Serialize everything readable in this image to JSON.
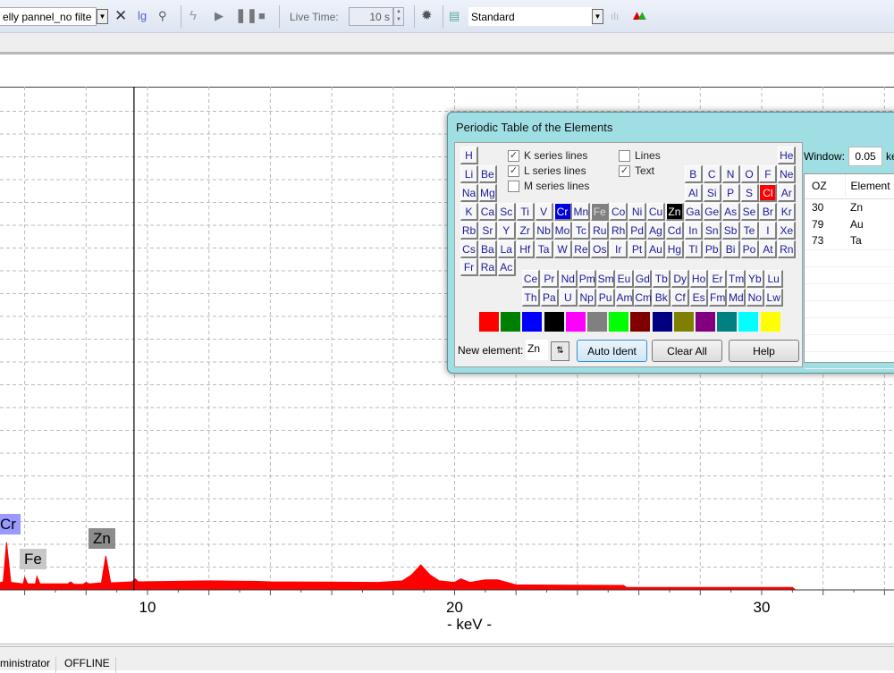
{
  "toolbar": {
    "profile_select": "elly pannel_no filte",
    "live_time_label": "Live Time:",
    "live_time_value": "10 s",
    "mode_select": "Standard",
    "icons": [
      "close-icon",
      "lg-icon",
      "zoom-icon",
      "lightning-icon",
      "play-icon",
      "pause-icon",
      "stop-icon",
      "gear-icon",
      "report-icon",
      "bar-chart-icon",
      "peaks-icon"
    ],
    "lg_label": "lg"
  },
  "status": {
    "user": "ministrator",
    "connection": "OFFLINE"
  },
  "chart_data": {
    "type": "area",
    "xlabel": "- keV -",
    "ylabel": "",
    "xlim": [
      5.18,
      34.3
    ],
    "ylim": [
      0,
      1000
    ],
    "grid": true,
    "xticks": [
      10,
      20,
      30
    ],
    "cursor_kev": 9.56,
    "color": "#ff0000",
    "points": [
      [
        5.18,
        14
      ],
      [
        5.3,
        16
      ],
      [
        5.41,
        95
      ],
      [
        5.55,
        15
      ],
      [
        5.95,
        12
      ],
      [
        6.0,
        25
      ],
      [
        6.1,
        12
      ],
      [
        6.35,
        12
      ],
      [
        6.4,
        27
      ],
      [
        6.5,
        12
      ],
      [
        7.4,
        12
      ],
      [
        7.5,
        16
      ],
      [
        7.6,
        11
      ],
      [
        7.9,
        11
      ],
      [
        8.0,
        15
      ],
      [
        8.1,
        12
      ],
      [
        8.5,
        14
      ],
      [
        8.64,
        68
      ],
      [
        8.8,
        14
      ],
      [
        9.5,
        16
      ],
      [
        9.6,
        22
      ],
      [
        9.7,
        16
      ],
      [
        12,
        18
      ],
      [
        13.6,
        17
      ],
      [
        14,
        16
      ],
      [
        17.5,
        15
      ],
      [
        18.3,
        18
      ],
      [
        18.6,
        30
      ],
      [
        18.9,
        50
      ],
      [
        19.2,
        30
      ],
      [
        19.5,
        18
      ],
      [
        20,
        15
      ],
      [
        20.2,
        22
      ],
      [
        20.5,
        15
      ],
      [
        21,
        20
      ],
      [
        21.4,
        20
      ],
      [
        22,
        10
      ],
      [
        25.5,
        9
      ],
      [
        25.6,
        5
      ],
      [
        31,
        5
      ],
      [
        31.1,
        0
      ]
    ],
    "labels": [
      {
        "text": "Cr",
        "kev": 5.41,
        "color": "#9999ff"
      },
      {
        "text": "Fe",
        "kev": 6.4,
        "color": "#c8c8c8"
      },
      {
        "text": "Zn",
        "kev": 8.64,
        "color": "#8c8c8c"
      }
    ]
  },
  "dialog": {
    "title": "Periodic Table of the Elements",
    "main_rows": [
      [
        "H",
        "",
        "",
        "",
        "",
        "",
        "",
        "",
        "",
        "",
        "",
        "",
        "",
        "",
        "",
        "",
        "",
        "He"
      ],
      [
        "Li",
        "Be",
        "",
        "",
        "",
        "",
        "",
        "",
        "",
        "",
        "",
        "",
        "B",
        "C",
        "N",
        "O",
        "F",
        "Ne"
      ],
      [
        "Na",
        "Mg",
        "",
        "",
        "",
        "",
        "",
        "",
        "",
        "",
        "",
        "",
        "Al",
        "Si",
        "P",
        "S",
        "Cl",
        "Ar"
      ],
      [
        "K",
        "Ca",
        "Sc",
        "Ti",
        "V",
        "Cr",
        "Mn",
        "Fe",
        "Co",
        "Ni",
        "Cu",
        "Zn",
        "Ga",
        "Ge",
        "As",
        "Se",
        "Br",
        "Kr"
      ],
      [
        "Rb",
        "Sr",
        "Y",
        "Zr",
        "Nb",
        "Mo",
        "Tc",
        "Ru",
        "Rh",
        "Pd",
        "Ag",
        "Cd",
        "In",
        "Sn",
        "Sb",
        "Te",
        "I",
        "Xe"
      ],
      [
        "Cs",
        "Ba",
        "La",
        "Hf",
        "Ta",
        "W",
        "Re",
        "Os",
        "Ir",
        "Pt",
        "Au",
        "Hg",
        "Tl",
        "Pb",
        "Bi",
        "Po",
        "At",
        "Rn"
      ],
      [
        "Fr",
        "Ra",
        "Ac"
      ]
    ],
    "f_rows": [
      [
        "Ce",
        "Pr",
        "Nd",
        "Pm",
        "Sm",
        "Eu",
        "Gd",
        "Tb",
        "Dy",
        "Ho",
        "Er",
        "Tm",
        "Yb",
        "Lu"
      ],
      [
        "Th",
        "Pa",
        "U",
        "Np",
        "Pu",
        "Am",
        "Cm",
        "Bk",
        "Cf",
        "Es",
        "Fm",
        "Md",
        "No",
        "Lw"
      ]
    ],
    "highlighted": {
      "Cr": "#0000e0",
      "Fe": "#808080",
      "Zn": "#000000",
      "Cl": "#ff0000"
    },
    "checkboxes": [
      {
        "label": "K series lines",
        "checked": true
      },
      {
        "label": "L series lines",
        "checked": true
      },
      {
        "label": "M series lines",
        "checked": false
      },
      {
        "label": "Lines",
        "checked": false
      },
      {
        "label": "Text",
        "checked": true
      }
    ],
    "palette": [
      "#ff0000",
      "#008000",
      "#0000ff",
      "#000000",
      "#ff00ff",
      "#808080",
      "#00ff00",
      "#800000",
      "#000080",
      "#808000",
      "#800080",
      "#008080",
      "#00ffff",
      "#ffff00"
    ],
    "new_element_label": "New element:",
    "new_element_value": "Zn",
    "auto_ident": "Auto Ident",
    "clear_all": "Clear All",
    "help": "Help",
    "window_label": "Window:",
    "window_value": "0.05",
    "window_unit": "ke",
    "table_headers": [
      "OZ",
      "Element"
    ],
    "table_rows": [
      [
        "30",
        "Zn"
      ],
      [
        "79",
        "Au"
      ],
      [
        "73",
        "Ta"
      ]
    ]
  }
}
